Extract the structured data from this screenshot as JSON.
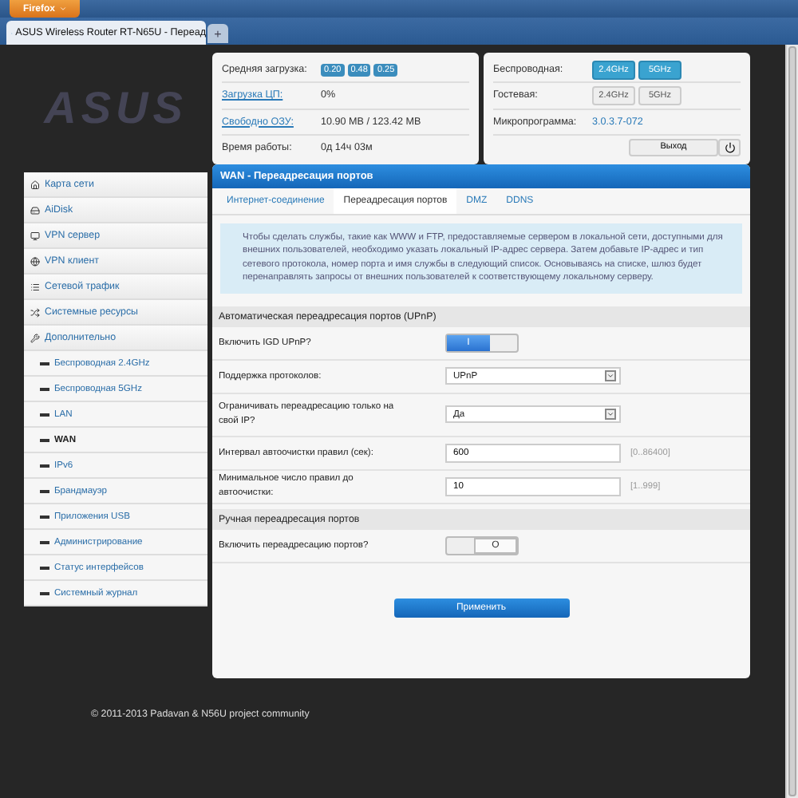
{
  "browser": {
    "menu_button": "Firefox",
    "tab_title": "ASUS Wireless Router RT-N65U - Переад",
    "new_tab": "+"
  },
  "logo": "ASUS",
  "status_left": [
    {
      "kind": "badges",
      "label": "Средняя загрузка:",
      "link": false,
      "badges": [
        "0.20",
        "0.48",
        "0.25"
      ]
    },
    {
      "kind": "text",
      "label": "Загрузка ЦП:",
      "link": true,
      "value": "0%"
    },
    {
      "kind": "text",
      "label": "Свободно ОЗУ:",
      "link": true,
      "value": "10.90 MB / 123.42 MB"
    },
    {
      "kind": "text",
      "label": "Время работы:",
      "link": false,
      "value": "0д 14ч 03м"
    }
  ],
  "status_right": [
    {
      "kind": "radios",
      "label": "Беспроводная:",
      "radios": [
        {
          "label": "2.4GHz",
          "on": true
        },
        {
          "label": "5GHz",
          "on": true
        }
      ]
    },
    {
      "kind": "radios",
      "label": "Гостевая:",
      "radios": [
        {
          "label": "2.4GHz",
          "on": false
        },
        {
          "label": "5GHz",
          "on": false
        }
      ]
    },
    {
      "kind": "link",
      "label": "Микропрограмма:",
      "value": "3.0.3.7-072"
    },
    {
      "kind": "logout",
      "button": "Выход"
    }
  ],
  "sidebar": {
    "items": [
      {
        "label": "Карта сети",
        "selected": false
      },
      {
        "label": "AiDisk",
        "selected": false
      },
      {
        "label": "VPN сервер",
        "selected": false
      },
      {
        "label": "VPN клиент",
        "selected": false
      },
      {
        "label": "Сетевой трафик",
        "selected": false
      },
      {
        "label": "Системные ресурсы",
        "selected": false
      },
      {
        "label": "Дополнительно",
        "selected": false,
        "children": [
          {
            "label": "Беспроводная 2.4GHz",
            "selected": false
          },
          {
            "label": "Беспроводная 5GHz",
            "selected": false
          },
          {
            "label": "LAN",
            "selected": false
          },
          {
            "label": "WAN",
            "selected": true
          },
          {
            "label": "IPv6",
            "selected": false
          },
          {
            "label": "Брандмауэр",
            "selected": false
          },
          {
            "label": "Приложения USB",
            "selected": false
          },
          {
            "label": "Администрирование",
            "selected": false
          },
          {
            "label": "Статус интерфейсов",
            "selected": false
          },
          {
            "label": "Системный журнал",
            "selected": false
          }
        ]
      }
    ]
  },
  "panel": {
    "title": "WAN - Переадресация портов",
    "tabs": [
      {
        "label": "Интернет-соединение",
        "selected": false
      },
      {
        "label": "Переадресация портов",
        "selected": true
      },
      {
        "label": "DMZ",
        "selected": false
      },
      {
        "label": "DDNS",
        "selected": false
      }
    ],
    "info": "Чтобы сделать службы, такие как WWW и FTP, предоставляемые сервером в локальной сети, доступными для внешних пользователей, необходимо указать локальный IP-адрес сервера. Затем добавьте IP-адрес и тип сетевого протокола, номер порта и имя службы в следующий список. Основываясь на списке, шлюз будет перенаправлять запросы от внешних пользователей к соответствующему локальному серверу.",
    "sections": [
      {
        "title": "Автоматическая переадресация портов (UPnP)",
        "rows": [
          {
            "kind": "toggle",
            "label": "Включить IGD UPnP?",
            "on": true,
            "glyph": "I"
          },
          {
            "kind": "select",
            "label": "Поддержка протоколов:",
            "value": "UPnP"
          },
          {
            "kind": "select",
            "label": "Ограничивать переадресацию только на свой IP?",
            "value": "Да"
          },
          {
            "kind": "input",
            "label": "Интервал автоочистки правил (сек):",
            "value": "600",
            "hint": "[0..86400]"
          },
          {
            "kind": "input",
            "label": "Минимальное число правил до автоочистки:",
            "value": "10",
            "hint": "[1..999]"
          }
        ]
      },
      {
        "title": "Ручная переадресация портов",
        "rows": [
          {
            "kind": "toggle",
            "label": "Включить переадресацию портов?",
            "on": false,
            "glyph": "O"
          }
        ]
      }
    ],
    "apply": "Применить"
  },
  "footer": "© 2011-2013 Padavan & N56U project community"
}
